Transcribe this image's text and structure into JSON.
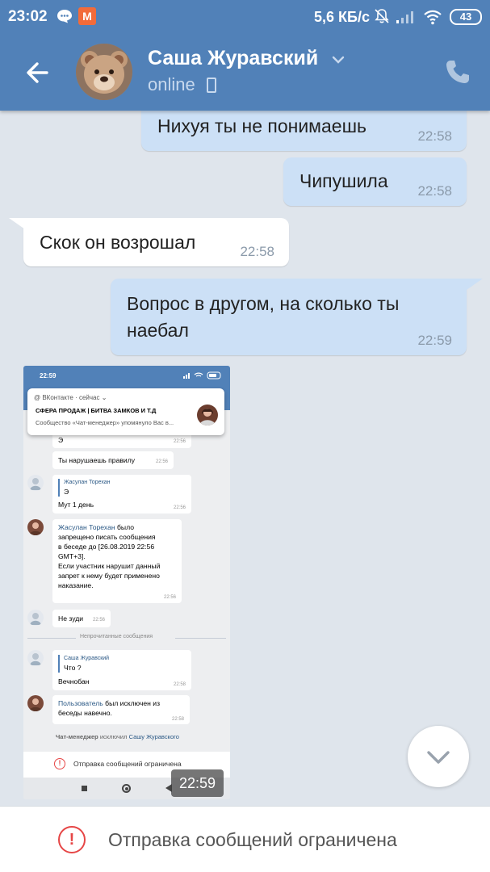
{
  "status_bar": {
    "time": "23:02",
    "app_badge": "M",
    "network_speed": "5,6 КБ/с",
    "battery": "43"
  },
  "header": {
    "name": "Саша Журавский",
    "status": "online"
  },
  "messages": [
    {
      "direction": "out",
      "text": "Нихуя ты не понимаешь",
      "time": "22:58"
    },
    {
      "direction": "out",
      "text": "Чипушила",
      "time": "22:58"
    },
    {
      "direction": "in",
      "text": "Скок он возрошал",
      "time": "22:58"
    },
    {
      "direction": "out",
      "text_line1": "Вопрос в другом, на сколько ты",
      "text_line2": "наебал",
      "time": "22:59"
    }
  ],
  "photo": {
    "time": "22:59",
    "inner_status_time": "22:59",
    "notification": {
      "app": "ВКонтакте · сейчас",
      "title": "СФЕРА ПРОДАЖ | БИТВА ЗАМКОВ И Т.Д",
      "body": "Сообщество «Чат-менеджер» упомянуло Вас в..."
    },
    "bubbles": [
      {
        "text": "Э",
        "time": "22:56"
      },
      {
        "text": "Ты нарушаешь правилу",
        "time": "22:56"
      },
      {
        "quote_name": "Жасулан Торехан",
        "quote_text": "Э",
        "text": "Мут 1 день",
        "time": "22:56"
      },
      {
        "link": "Жасулан Торехан",
        "line1_rest": " было",
        "line2": "запрещено писать сообщения",
        "line3": "в беседе до [26.08.2019 22:56",
        "line4": "GMT+3].",
        "line5": "Если участник нарушит данный",
        "line6": "запрет к нему будет применено",
        "line7": "наказание.",
        "time": "22:56"
      },
      {
        "text": "Не зуди",
        "time": "22:56"
      },
      {
        "quote_name": "Саша Журавский",
        "quote_text": "Что ?",
        "text": "Вечнобан",
        "time": "22:58"
      },
      {
        "link": "Пользователь",
        "line1_rest": " был исключен из",
        "line2": "беседы навечно.",
        "time": "22:58"
      }
    ],
    "divider": "Непрочитанные сообщения",
    "system": {
      "actor": "Чат-менеджер",
      "action": " исключил ",
      "target": "Сашу Журавского"
    },
    "restricted": "Отправка сообщений ограничена"
  },
  "bottom": {
    "restricted_text": "Отправка сообщений ограничена",
    "icon_glyph": "!"
  },
  "colors": {
    "header": "#5181b8",
    "outgoing_bubble": "#cce0f6",
    "incoming_bubble": "#ffffff",
    "background": "#dfe5ec",
    "restricted_icon": "#e64646"
  }
}
